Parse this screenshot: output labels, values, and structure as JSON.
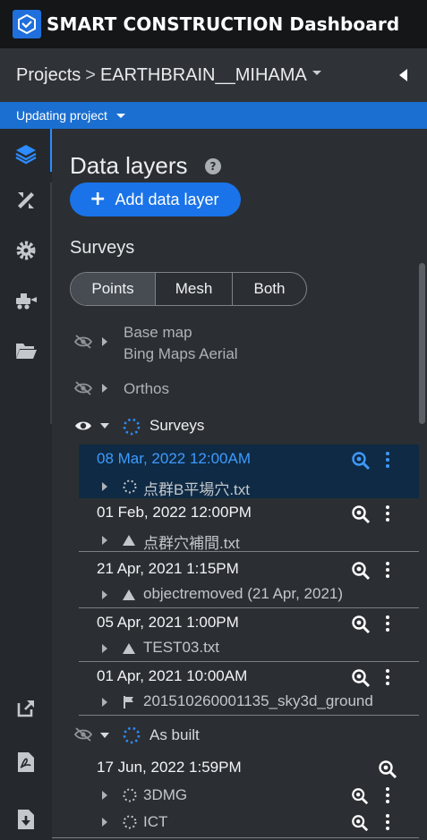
{
  "app": {
    "title": "SMART CONSTRUCTION Dashboard",
    "logo_icon": "smart-construction-logo"
  },
  "breadcrumb": {
    "root": "Projects",
    "separator": ">",
    "project": "EARTHBRAIN__MIHAMA"
  },
  "status": {
    "label": "Updating project"
  },
  "rail": {
    "items": [
      {
        "name": "layers-icon",
        "active": true
      },
      {
        "name": "measure-tools-icon",
        "active": false
      },
      {
        "name": "settings-gear-icon",
        "active": false
      },
      {
        "name": "machine-icon",
        "active": false
      },
      {
        "name": "folder-open-icon",
        "active": false
      },
      {
        "name": "external-link-icon",
        "active": false
      },
      {
        "name": "pdf-icon",
        "active": false
      },
      {
        "name": "download-icon",
        "active": false
      }
    ]
  },
  "panel": {
    "title": "Data layers",
    "add_button": "Add data layer",
    "surveys_heading": "Surveys",
    "segments": {
      "points": "Points",
      "mesh": "Mesh",
      "both": "Both",
      "selected": "Points"
    },
    "base_map": {
      "label": "Base map",
      "value": "Bing Maps Aerial",
      "visible": false
    },
    "orthos": {
      "label": "Orthos",
      "visible": false
    },
    "surveys_group": {
      "label": "Surveys",
      "visible": true
    },
    "surveys": [
      {
        "date": "08 Mar, 2022 12:00AM",
        "file": "点群B平場穴.txt",
        "file_icon": "loading-icon",
        "selected": true
      },
      {
        "date": "01 Feb, 2022 12:00PM",
        "file": "点群穴補間.txt",
        "file_icon": "triangle-icon",
        "selected": false
      },
      {
        "date": "21 Apr, 2021 1:15PM",
        "file": "objectremoved (21 Apr, 2021)",
        "file_icon": "triangle-icon",
        "selected": false
      },
      {
        "date": "05 Apr, 2021 1:00PM",
        "file": "TEST03.txt",
        "file_icon": "triangle-icon",
        "selected": false
      },
      {
        "date": "01 Apr, 2021 10:00AM",
        "file": "201510260001135_sky3d_ground",
        "file_icon": "flag-icon",
        "selected": false
      }
    ],
    "as_built_group": {
      "label": "As built",
      "visible": false
    },
    "as_built": {
      "date": "17 Jun, 2022 1:59PM",
      "items": [
        {
          "label": "3DMG"
        },
        {
          "label": "ICT"
        }
      ]
    }
  },
  "colors": {
    "accent": "#1a73e8",
    "status_bar": "#1b6fd1",
    "selected_row": "#0f2a44",
    "selected_text": "#3d9bff"
  }
}
